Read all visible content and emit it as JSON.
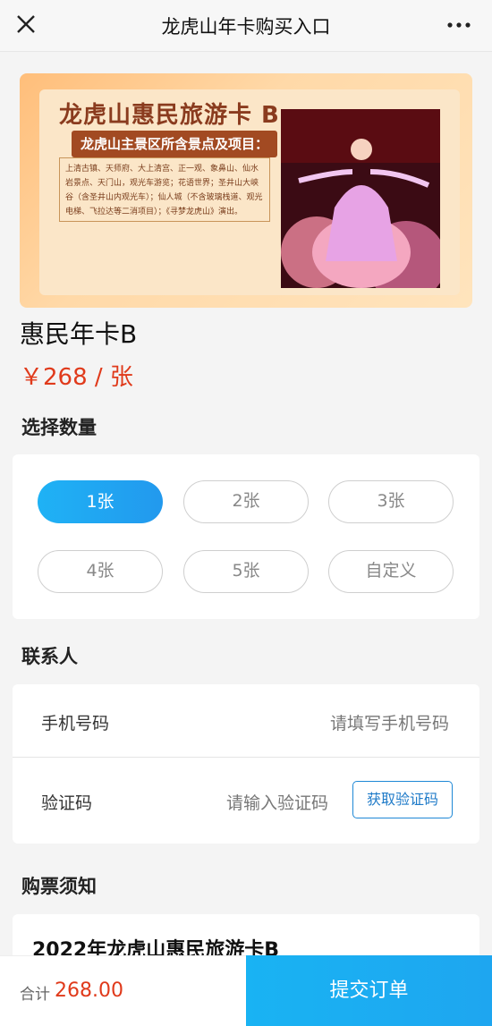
{
  "header": {
    "title": "龙虎山年卡购买入口",
    "close_icon": "close-icon",
    "more_icon": "more-dots-icon"
  },
  "banner": {
    "title": "龙虎山惠民旅游卡 B",
    "subtitle": "龙虎山主景区所含景点及项目：",
    "description": "上清古镇、天师府、大上清宫、正一观、象鼻山、仙水岩景点、天门山，观光车游览；花语世界；圣井山大峡谷（含圣井山内观光车）；仙人城（不含玻璃栈道、观光电梯、飞拉达等二消项目）；《寻梦龙虎山》演出。"
  },
  "product": {
    "name": "惠民年卡B",
    "price": "￥268 / 张"
  },
  "quantity": {
    "section_title": "选择数量",
    "options": [
      "1张",
      "2张",
      "3张",
      "4张",
      "5张",
      "自定义"
    ],
    "selected": "1张"
  },
  "contact": {
    "section_title": "联系人",
    "phone_label": "手机号码",
    "phone_placeholder": "请填写手机号码",
    "code_label": "验证码",
    "code_placeholder": "请输入验证码",
    "get_code_label": "获取验证码"
  },
  "notice": {
    "section_title": "购票须知",
    "heading": "2022年龙虎山惠民旅游卡B"
  },
  "footer": {
    "total_label": "合计",
    "total_value": "268.00",
    "submit_label": "提交订单"
  },
  "colors": {
    "accent": "#1fb2f5",
    "price": "#e03a1b",
    "banner": "#ffbe7a"
  }
}
